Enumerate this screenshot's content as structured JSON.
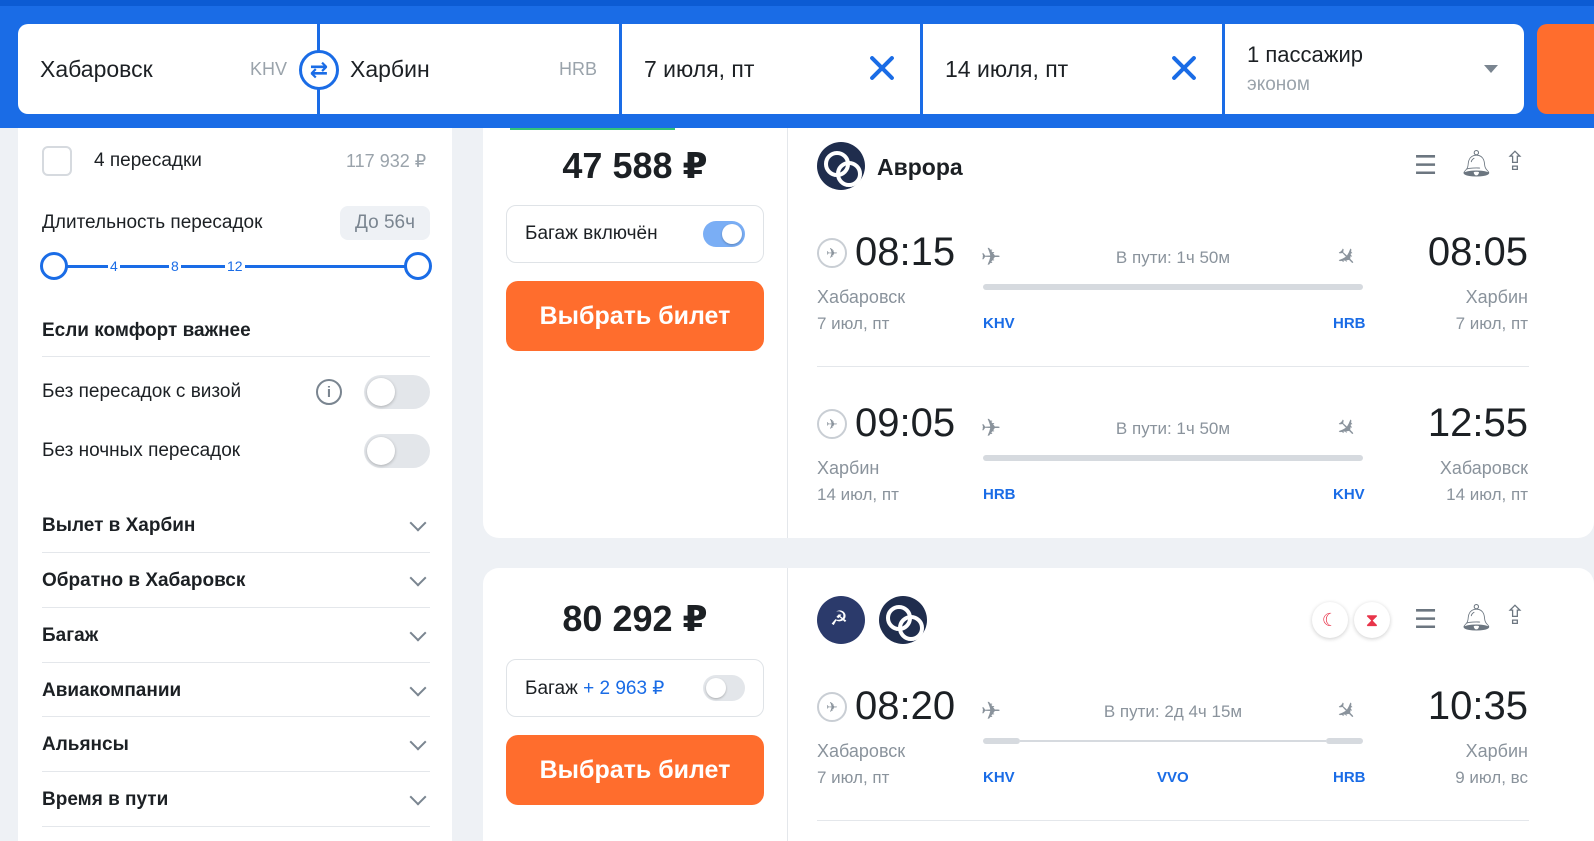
{
  "search": {
    "origin_city": "Хабаровск",
    "origin_code": "KHV",
    "swap_icon": "swap-arrows-icon",
    "dest_city": "Харбин",
    "dest_code": "HRB",
    "depart_date": "7 июля, пт",
    "return_date": "14 июля, пт",
    "passengers": "1 пассажир",
    "cabin": "эконом"
  },
  "filters": {
    "stops_option": {
      "label": "4 пересадки",
      "price": "117 932 ₽"
    },
    "layover": {
      "label": "Длительность пересадок",
      "value": "До 56ч",
      "ticks": [
        "4",
        "8",
        "12"
      ]
    },
    "comfort_title": "Если комфорт важнее",
    "no_visa_transfers": "Без пересадок с визой",
    "no_night_transfers": "Без ночных пересадок",
    "sections": [
      "Вылет в Харбин",
      "Обратно в Хабаровск",
      "Багаж",
      "Авиакомпании",
      "Альянсы",
      "Время в пути"
    ]
  },
  "tickets": [
    {
      "price": "47 588 ₽",
      "baggage_label": "Багаж включён",
      "baggage_on": true,
      "button": "Выбрать билет",
      "airline": "Аврора",
      "legs": [
        {
          "dep_time": "08:15",
          "arr_time": "08:05",
          "duration": "В пути: 1ч 50м",
          "from_city": "Хабаровск",
          "to_city": "Харбин",
          "from_date": "7 июл, пт",
          "to_date": "7 июл, пт",
          "from_code": "KHV",
          "to_code": "HRB"
        },
        {
          "dep_time": "09:05",
          "arr_time": "12:55",
          "duration": "В пути: 1ч 50м",
          "from_city": "Харбин",
          "to_city": "Хабаровск",
          "from_date": "14 июл, пт",
          "to_date": "14 июл, пт",
          "from_code": "HRB",
          "to_code": "KHV"
        }
      ]
    },
    {
      "price": "80 292 ₽",
      "baggage_label": "Багаж",
      "baggage_extra": "+ 2 963 ₽",
      "baggage_on": false,
      "button": "Выбрать билет",
      "legs": [
        {
          "dep_time": "08:20",
          "arr_time": "10:35",
          "duration": "В пути: 2д 4ч 15м",
          "from_city": "Хабаровск",
          "to_city": "Харбин",
          "from_date": "7 июл, пт",
          "to_date": "9 июл, вс",
          "from_code": "KHV",
          "via_code": "VVO",
          "to_code": "HRB"
        }
      ]
    }
  ],
  "colors": {
    "brand_blue": "#1a6ce6",
    "accent_orange": "#ff6d2d",
    "alert_red": "#e8344a"
  }
}
